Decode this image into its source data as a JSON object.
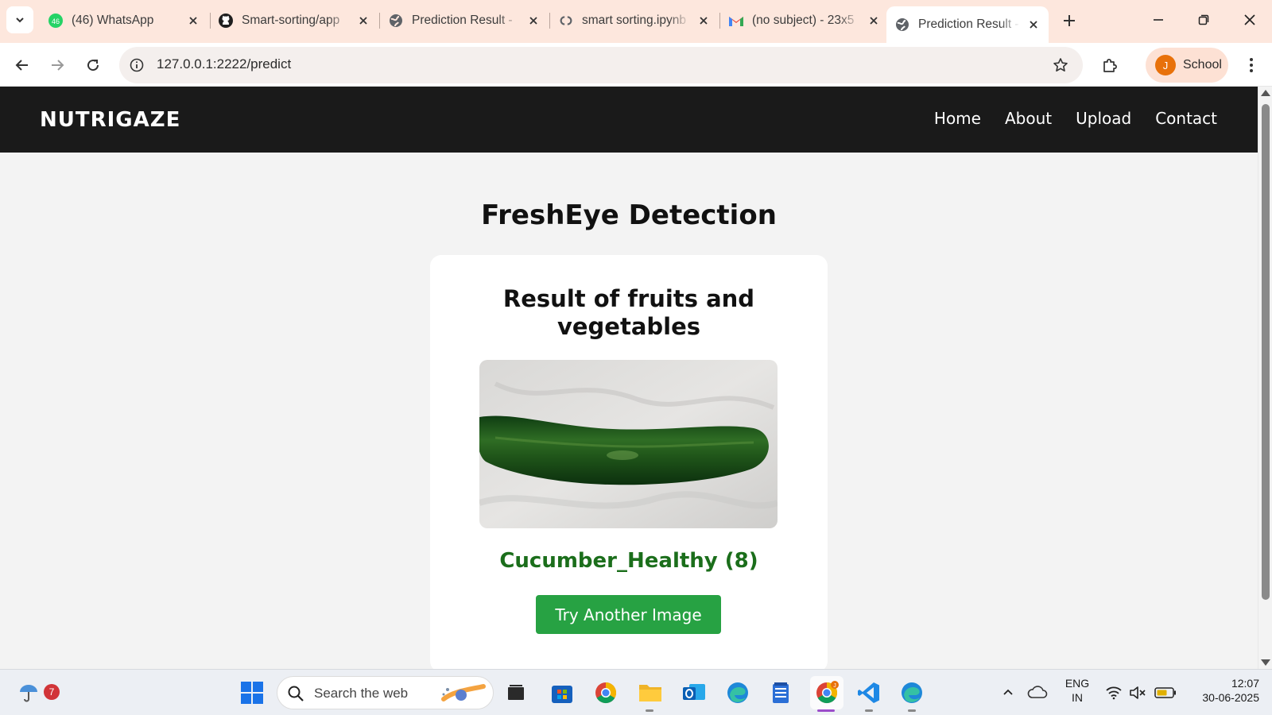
{
  "browser": {
    "tabs": [
      {
        "title": "(46) WhatsApp",
        "favicon": "whatsapp-icon"
      },
      {
        "title": "Smart-sorting/app",
        "favicon": "github-icon"
      },
      {
        "title": "Prediction Result -",
        "favicon": "globe-icon"
      },
      {
        "title": "smart sorting.ipynb",
        "favicon": "colab-icon"
      },
      {
        "title": "(no subject) - 23x5",
        "favicon": "gmail-icon"
      },
      {
        "title": "Prediction Result -",
        "favicon": "globe-icon",
        "active": true
      }
    ],
    "whatsapp_badge": "46",
    "url": "127.0.0.1:2222/predict",
    "profile_initial": "J",
    "profile_name": "School"
  },
  "site": {
    "brand": "NUTRIGAZE",
    "nav": [
      "Home",
      "About",
      "Upload",
      "Contact"
    ],
    "page_title": "FreshEye Detection",
    "card_title": "Result of fruits and vegetables",
    "result_text": "Cucumber_Healthy (8)",
    "button_label": "Try Another Image"
  },
  "taskbar": {
    "weather_badge": "7",
    "search_placeholder": "Search the web",
    "lang_line1": "ENG",
    "lang_line2": "IN",
    "time": "12:07",
    "date": "30-06-2025",
    "chrome_badge": "J"
  },
  "colors": {
    "titlebar": "#fde7dd",
    "site_nav": "#1a1a1a",
    "result_green": "#1b6e1b",
    "button_green": "#27a243"
  }
}
